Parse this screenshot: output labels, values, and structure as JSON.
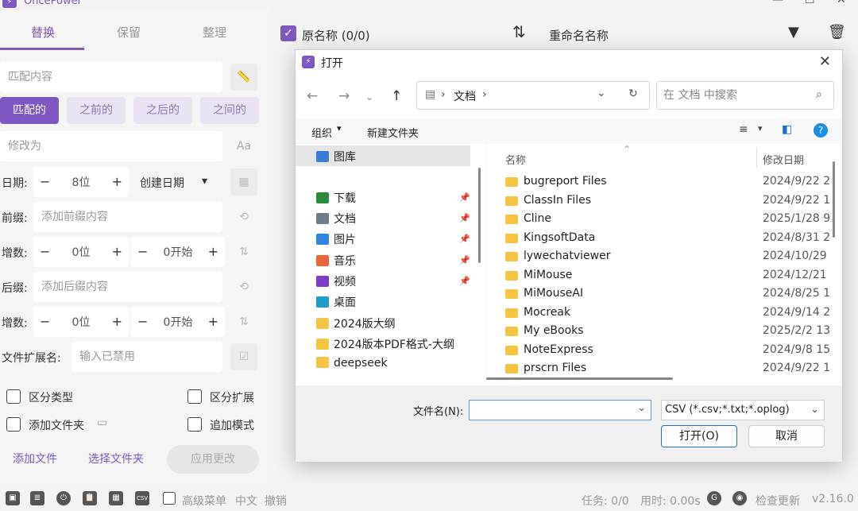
{
  "app": {
    "title": "OncePower",
    "logo_glyph": "⚡"
  },
  "window": {
    "minimize": "—",
    "maximize": "☐",
    "close": "✕"
  },
  "tabs": [
    "替换",
    "保留",
    "整理"
  ],
  "replace": {
    "match_placeholder": "匹配内容",
    "chips": [
      "匹配的",
      "之前的",
      "之后的",
      "之间的"
    ],
    "modify_placeholder": "修改为",
    "date_label": "日期:",
    "date_digits": "8位",
    "date_type": "创建日期",
    "prefix_label": "前缀:",
    "prefix_placeholder": "添加前缀内容",
    "incr1_label": "增数:",
    "incr1_digits": "0位",
    "incr1_start": "0开始",
    "suffix_label": "后缀:",
    "suffix_placeholder": "添加后缀内容",
    "incr2_label": "增数:",
    "incr2_digits": "0位",
    "incr2_start": "0开始",
    "ext_label": "文件扩展名:",
    "ext_placeholder": "输入已禁用",
    "opt_case": "区分类型",
    "opt_ext": "区分扩展",
    "opt_folder": "添加文件夹",
    "opt_append": "追加模式",
    "btn_add_file": "添加文件",
    "btn_select_folder": "选择文件夹",
    "btn_apply": "应用更改"
  },
  "header": {
    "orig_name": "原名称 (0/0)",
    "new_name": "重命名名称"
  },
  "dialog": {
    "title": "打开",
    "address": [
      "文档"
    ],
    "search_placeholder": "在 文档 中搜索",
    "organize": "组织",
    "new_folder": "新建文件夹",
    "nav": [
      {
        "label": "图库",
        "color": "#3a7bd5",
        "pinned": false
      },
      {
        "label": "下载",
        "color": "#2a8a3a",
        "pinned": true
      },
      {
        "label": "文档",
        "color": "#6c7a89",
        "pinned": true
      },
      {
        "label": "图片",
        "color": "#2e86de",
        "pinned": true
      },
      {
        "label": "音乐",
        "color": "#e8673c",
        "pinned": true
      },
      {
        "label": "视频",
        "color": "#7d3cc8",
        "pinned": true
      },
      {
        "label": "桌面",
        "color": "#1aa0c8",
        "pinned": false
      },
      {
        "label": "2024版大纲",
        "color": "#f4c542",
        "pinned": false
      },
      {
        "label": "2024版本PDF格式-大纲",
        "color": "#f4c542",
        "pinned": false
      },
      {
        "label": "deepseek",
        "color": "#f4c542",
        "pinned": false
      }
    ],
    "columns": {
      "name": "名称",
      "date": "修改日期"
    },
    "files": [
      {
        "name": "bugreport Files",
        "date": "2024/9/22 2"
      },
      {
        "name": "ClassIn Files",
        "date": "2024/9/22 1"
      },
      {
        "name": "Cline",
        "date": "2025/1/28 9"
      },
      {
        "name": "KingsoftData",
        "date": "2024/8/31 2"
      },
      {
        "name": "lywechatviewer",
        "date": "2024/10/29"
      },
      {
        "name": "MiMouse",
        "date": "2024/12/21"
      },
      {
        "name": "MiMouseAI",
        "date": "2024/8/25 1"
      },
      {
        "name": "Mocreak",
        "date": "2024/9/14 2"
      },
      {
        "name": "My eBooks",
        "date": "2025/2/2 13"
      },
      {
        "name": "NoteExpress",
        "date": "2024/9/8 15"
      },
      {
        "name": "prscrn Files",
        "date": "2024/9/22 1"
      }
    ],
    "filename_label": "文件名(N):",
    "filetype": "CSV (*.csv;*.txt;*.oplog)",
    "open_btn": "打开(O)",
    "cancel_btn": "取消"
  },
  "status": {
    "adv_menu": "高级菜单",
    "lang": "中文",
    "undo": "撤销",
    "tasks": "任务: 0/0",
    "time": "用时: 0.00s",
    "check_update": "检查更新",
    "version": "v2.16.0"
  }
}
